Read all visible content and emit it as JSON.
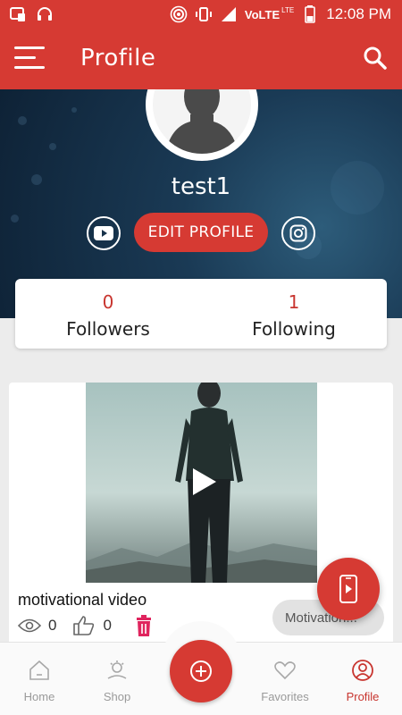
{
  "status_bar": {
    "network_label": "VoLTE",
    "lte_label": "LTE",
    "time": "12:08 PM"
  },
  "app_bar": {
    "title": "Profile"
  },
  "profile": {
    "username": "test1",
    "edit_button_label": "EDIT PROFILE"
  },
  "stats": {
    "followers": {
      "count": "0",
      "label": "Followers"
    },
    "following": {
      "count": "1",
      "label": "Following"
    }
  },
  "video": {
    "title": "motivational video",
    "views": "0",
    "likes": "0",
    "category": "Motivation..."
  },
  "bottom_nav": {
    "items": [
      {
        "label": "Home",
        "icon": "home-icon"
      },
      {
        "label": "Shop",
        "icon": "shop-icon"
      },
      {
        "label": "Favorites",
        "icon": "heart-icon"
      },
      {
        "label": "Profile",
        "icon": "user-circle-icon"
      }
    ],
    "active": "Profile"
  },
  "colors": {
    "primary": "#d63a33",
    "count": "#c8352f",
    "background": "#ececec",
    "delete": "#e0245e"
  }
}
